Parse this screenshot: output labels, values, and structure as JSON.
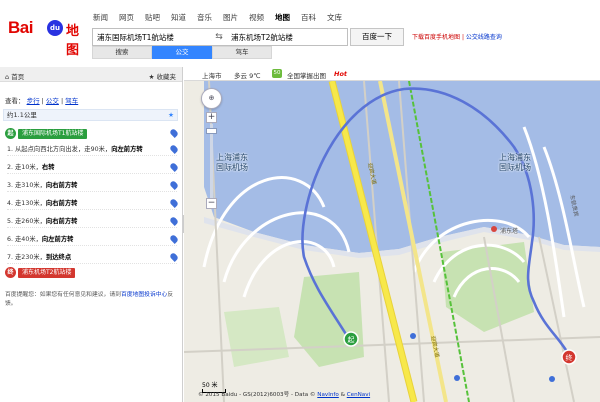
{
  "logo": {
    "text_bai": "Bai",
    "text_du": "du",
    "text_ditu": "地图"
  },
  "topnav": [
    {
      "label": "新闻",
      "active": false
    },
    {
      "label": "网页",
      "active": false
    },
    {
      "label": "贴吧",
      "active": false
    },
    {
      "label": "知道",
      "active": false
    },
    {
      "label": "音乐",
      "active": false
    },
    {
      "label": "图片",
      "active": false
    },
    {
      "label": "视频",
      "active": false
    },
    {
      "label": "地图",
      "active": true
    },
    {
      "label": "百科",
      "active": false
    },
    {
      "label": "文库",
      "active": false
    }
  ],
  "search": {
    "start_value": "浦东国际机场T1航站楼",
    "end_value": "浦东机场T2航站楼",
    "button_label": "百度一下"
  },
  "toplinks": {
    "mobile": "下载百度手机地图",
    "separator": "|",
    "bus_help": "公交线路查询"
  },
  "mode_tabs": [
    {
      "label": "搜索",
      "active": false
    },
    {
      "label": "公交",
      "active": true
    },
    {
      "label": "驾车",
      "active": false
    }
  ],
  "sidebar": {
    "home_label": "首页",
    "fav_label": "收藏夹",
    "view_prefix": "查看：",
    "view_links": [
      "步行",
      "公交",
      "驾车"
    ],
    "distance": "约1.1公里",
    "start_badge": "起",
    "start_name": "浦东国际机场T1航站楼",
    "end_badge": "终",
    "end_name": "浦东机场T2航站楼",
    "steps": [
      {
        "text": "1. 从起点向西北方向出发，走90米，",
        "bold": "向左前方转"
      },
      {
        "text": "2. 走10米，",
        "bold": "右转"
      },
      {
        "text": "3. 走310米，",
        "bold": "向右前方转"
      },
      {
        "text": "4. 走130米，",
        "bold": "向右前方转"
      },
      {
        "text": "5. 走260米，",
        "bold": "向右前方转"
      },
      {
        "text": "6. 走40米，",
        "bold": "向左前方转"
      },
      {
        "text": "7. 走230米，",
        "bold": "到达终点"
      }
    ],
    "feedback_text": "百度提醒您：如果您有任何意见和建议，请到",
    "feedback_link": "百度地图投诉中心",
    "feedback_end": "反馈。",
    "collapse_arrow": "‹"
  },
  "map": {
    "city": "上海市",
    "weather": "多云 9℃",
    "aqi": "50",
    "traffic_label": "全国掌握出图",
    "hot_label": "Hot",
    "label_left": "上海浦东\n国际机场",
    "label_right": "上海浦东\n国际机场",
    "road_label_1": "迎宾大道",
    "road_label_2": "迎宾大道",
    "poi_label": "浦东塔",
    "east_label": "东航贵宾",
    "scale_label": "50 米",
    "copyright_text": "© 2015 Baidu - GS(2012)6003号 - Data © ",
    "copyright_link1": "NavInfo",
    "copyright_amp": " & ",
    "copyright_link2": "CenNavi",
    "pan_icon": "⊕",
    "zoom_in": "+",
    "zoom_out": "−",
    "colors": {
      "water": "#a4bce6",
      "road_yellow": "#f7e84a",
      "route": "#5a73d6",
      "metro_green": "#56c23a",
      "park": "#c7e2b2"
    }
  }
}
